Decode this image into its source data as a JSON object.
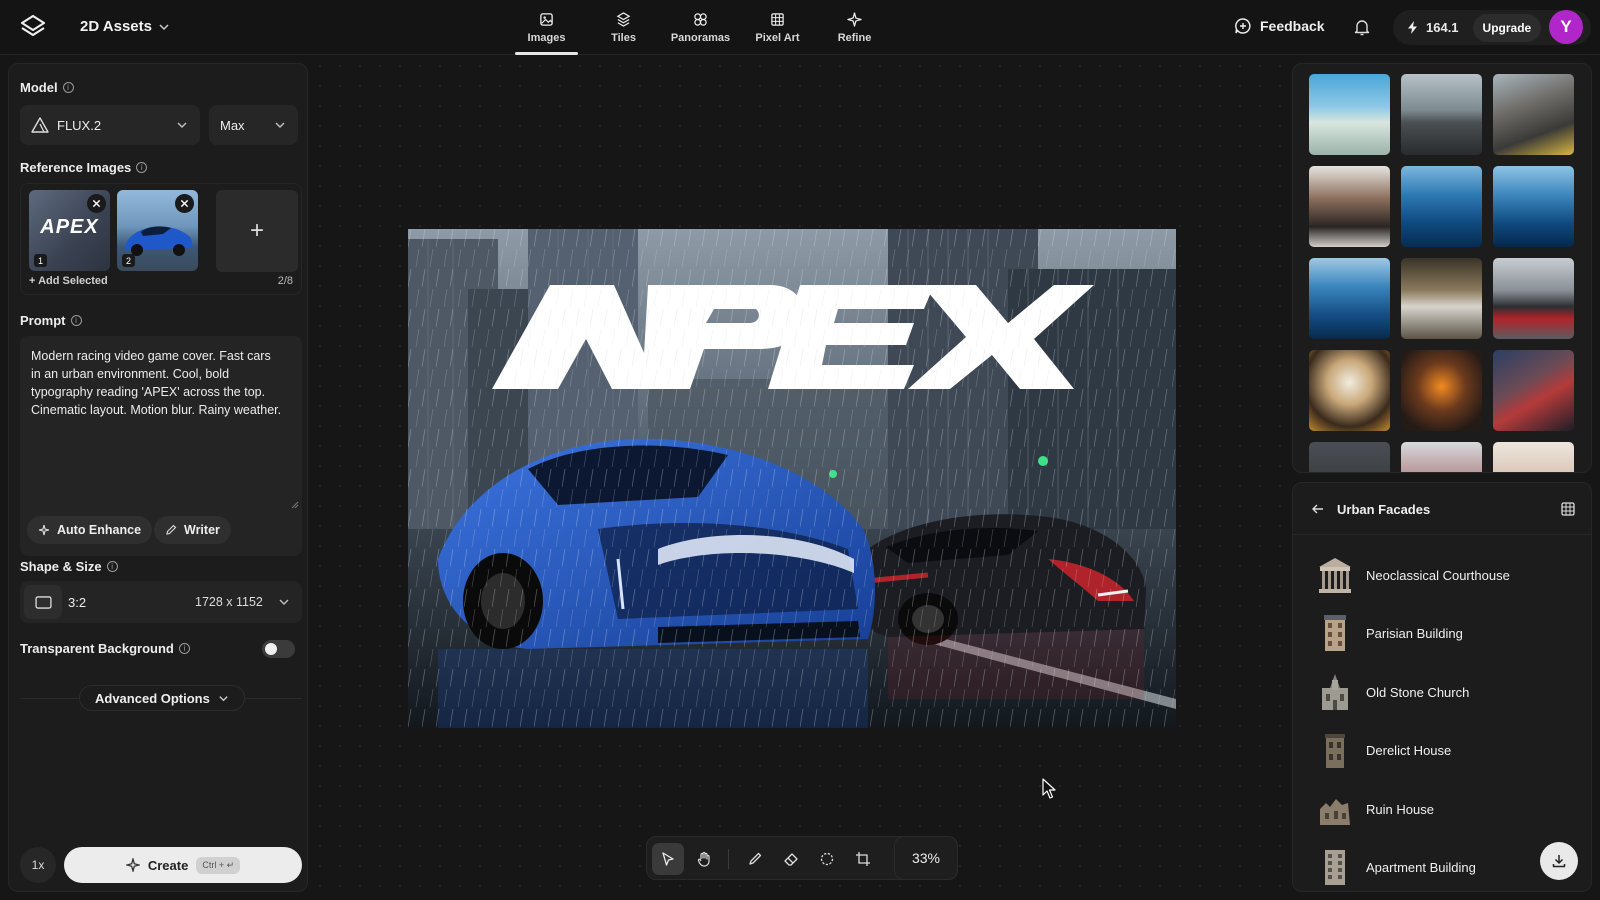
{
  "header": {
    "project_title": "2D Assets",
    "modes": [
      {
        "label": "Images",
        "icon": "image-icon",
        "active": true
      },
      {
        "label": "Tiles",
        "icon": "tiles-icon",
        "active": false
      },
      {
        "label": "Panoramas",
        "icon": "panorama-icon",
        "active": false
      },
      {
        "label": "Pixel Art",
        "icon": "pixel-grid-icon",
        "active": false
      },
      {
        "label": "Refine",
        "icon": "sparkle-icon",
        "active": false
      }
    ],
    "feedback_label": "Feedback",
    "credits": "164.1",
    "upgrade_label": "Upgrade",
    "avatar_initial": "Y"
  },
  "left_panel": {
    "model_label": "Model",
    "model_value": "FLUX.2",
    "quality_value": "Max",
    "reference_label": "Reference Images",
    "reference_images": [
      {
        "number": "1",
        "logo_text": "APEX"
      },
      {
        "number": "2"
      }
    ],
    "add_tile_label": "+",
    "add_selected_label": "+ Add Selected",
    "reference_count": "2/8",
    "prompt_label": "Prompt",
    "prompt_text": "Modern racing video game cover. Fast cars in an urban environment. Cool, bold typography reading 'APEX' across the top. Cinematic layout. Motion blur. Rainy weather.",
    "auto_enhance_label": "Auto Enhance",
    "writer_label": "Writer",
    "shape_label": "Shape & Size",
    "aspect_ratio": "3:2",
    "dimensions": "1728 x 1152",
    "transparent_label": "Transparent Background",
    "transparent_enabled": false,
    "advanced_label": "Advanced Options",
    "multiplier": "1x",
    "create_label": "Create",
    "create_shortcut": "Ctrl + ↵"
  },
  "canvas": {
    "artwork_title": "APEX",
    "zoom": "33%",
    "tools": [
      "select-tool-icon",
      "hand-tool-icon",
      "brush-tool-icon",
      "eraser-tool-icon",
      "lasso-tool-icon",
      "crop-tool-icon"
    ]
  },
  "gallery": {
    "thumbnails": [
      "coastal-car",
      "cyclist-road",
      "cyclist-mountain",
      "friends-portrait",
      "whale-underwater",
      "whale-surface",
      "whale-tail",
      "street-crowd",
      "race-car-rain",
      "festival-lights",
      "orange-sunglasses",
      "face-paint"
    ]
  },
  "asset_library": {
    "title": "Urban Facades",
    "items": [
      {
        "label": "Neoclassical Courthouse"
      },
      {
        "label": "Parisian Building"
      },
      {
        "label": "Old Stone Church"
      },
      {
        "label": "Derelict House"
      },
      {
        "label": "Ruin House"
      },
      {
        "label": "Apartment Building"
      }
    ]
  },
  "colors": {
    "background": "#161616",
    "panel": "#1c1c1c",
    "accent_avatar": "#b026c8",
    "car_blue": "#1f4fb5",
    "car_red": "#b0232a"
  }
}
